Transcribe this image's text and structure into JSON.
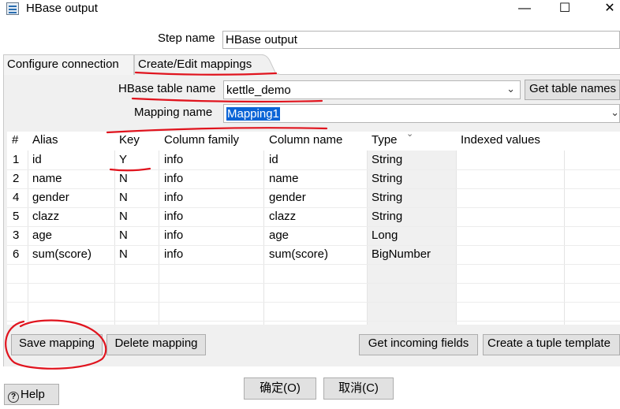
{
  "window": {
    "title": "HBase output",
    "minimize_glyph": "—",
    "maximize_glyph": "☐",
    "close_glyph": "✕"
  },
  "step_name": {
    "label": "Step name",
    "value": "HBase output"
  },
  "tabs": [
    {
      "label": "Configure connection",
      "active": false
    },
    {
      "label": "Create/Edit mappings",
      "active": true
    }
  ],
  "mapping_form": {
    "hbase_table_label": "HBase table name",
    "hbase_table_value": "kettle_demo",
    "get_table_names_button": "Get table names",
    "mapping_name_label": "Mapping name",
    "mapping_name_value": "Mapping1"
  },
  "table": {
    "columns": [
      "#",
      "Alias",
      "Key",
      "Column family",
      "Column name",
      "Type",
      "Indexed values"
    ],
    "rows": [
      {
        "num": "1",
        "alias": "id",
        "key": "Y",
        "family": "info",
        "column": "id",
        "type": "String",
        "indexed": ""
      },
      {
        "num": "2",
        "alias": "name",
        "key": "N",
        "family": "info",
        "column": "name",
        "type": "String",
        "indexed": ""
      },
      {
        "num": "4",
        "alias": "gender",
        "key": "N",
        "family": "info",
        "column": "gender",
        "type": "String",
        "indexed": ""
      },
      {
        "num": "5",
        "alias": "clazz",
        "key": "N",
        "family": "info",
        "column": "clazz",
        "type": "String",
        "indexed": ""
      },
      {
        "num": "3",
        "alias": "age",
        "key": "N",
        "family": "info",
        "column": "age",
        "type": "Long",
        "indexed": ""
      },
      {
        "num": "6",
        "alias": "sum(score)",
        "key": "N",
        "family": "info",
        "column": "sum(score)",
        "type": "BigNumber",
        "indexed": ""
      }
    ]
  },
  "buttons": {
    "save_mapping": "Save mapping",
    "delete_mapping": "Delete mapping",
    "get_incoming_fields": "Get incoming fields",
    "create_tuple_template": "Create a tuple template",
    "ok": "确定(O)",
    "cancel": "取消(C)",
    "help": "Help"
  },
  "colors": {
    "annotation_red": "#e0141e",
    "selection_blue": "#0a64d6",
    "panel_bg": "#f0f0f0"
  }
}
